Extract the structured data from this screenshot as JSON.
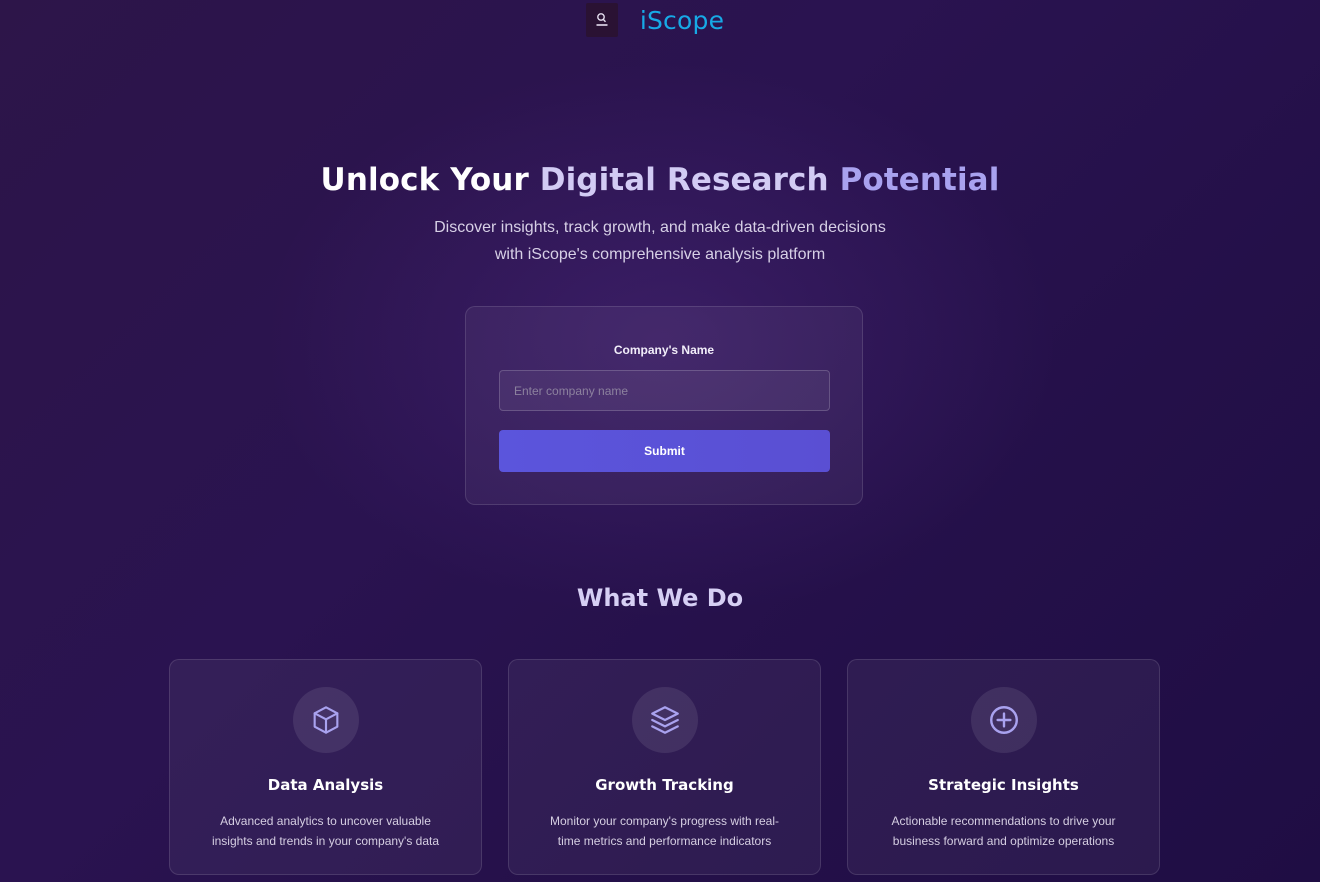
{
  "header": {
    "brand_name": "iScope",
    "logo_icon": "search-person-icon"
  },
  "hero": {
    "title_part1": "Unlock Your ",
    "title_part2": "Digital Research ",
    "title_part3": "Potential",
    "subtitle_line1": "Discover insights, track growth, and make data-driven decisions",
    "subtitle_line2": "with iScope's comprehensive analysis platform"
  },
  "form": {
    "label": "Company's Name",
    "input_placeholder": "Enter company name",
    "input_value": "",
    "submit_label": "Submit"
  },
  "what_we_do": {
    "title": "What We Do",
    "cards": [
      {
        "icon": "cube-icon",
        "title": "Data Analysis",
        "desc_line1": "Advanced analytics to uncover valuable",
        "desc_line2": "insights and trends in your company's data"
      },
      {
        "icon": "layers-icon",
        "title": "Growth Tracking",
        "desc_line1": "Monitor your company's progress with real-",
        "desc_line2": "time metrics and performance indicators"
      },
      {
        "icon": "plus-circle-icon",
        "title": "Strategic Insights",
        "desc_line1": "Actionable recommendations to drive your",
        "desc_line2": "business forward and optimize operations"
      }
    ]
  },
  "colors": {
    "brand": "#17a9e6",
    "accent": "#5b55dc",
    "icon": "#a9a2ef",
    "background": "#2a1350"
  }
}
